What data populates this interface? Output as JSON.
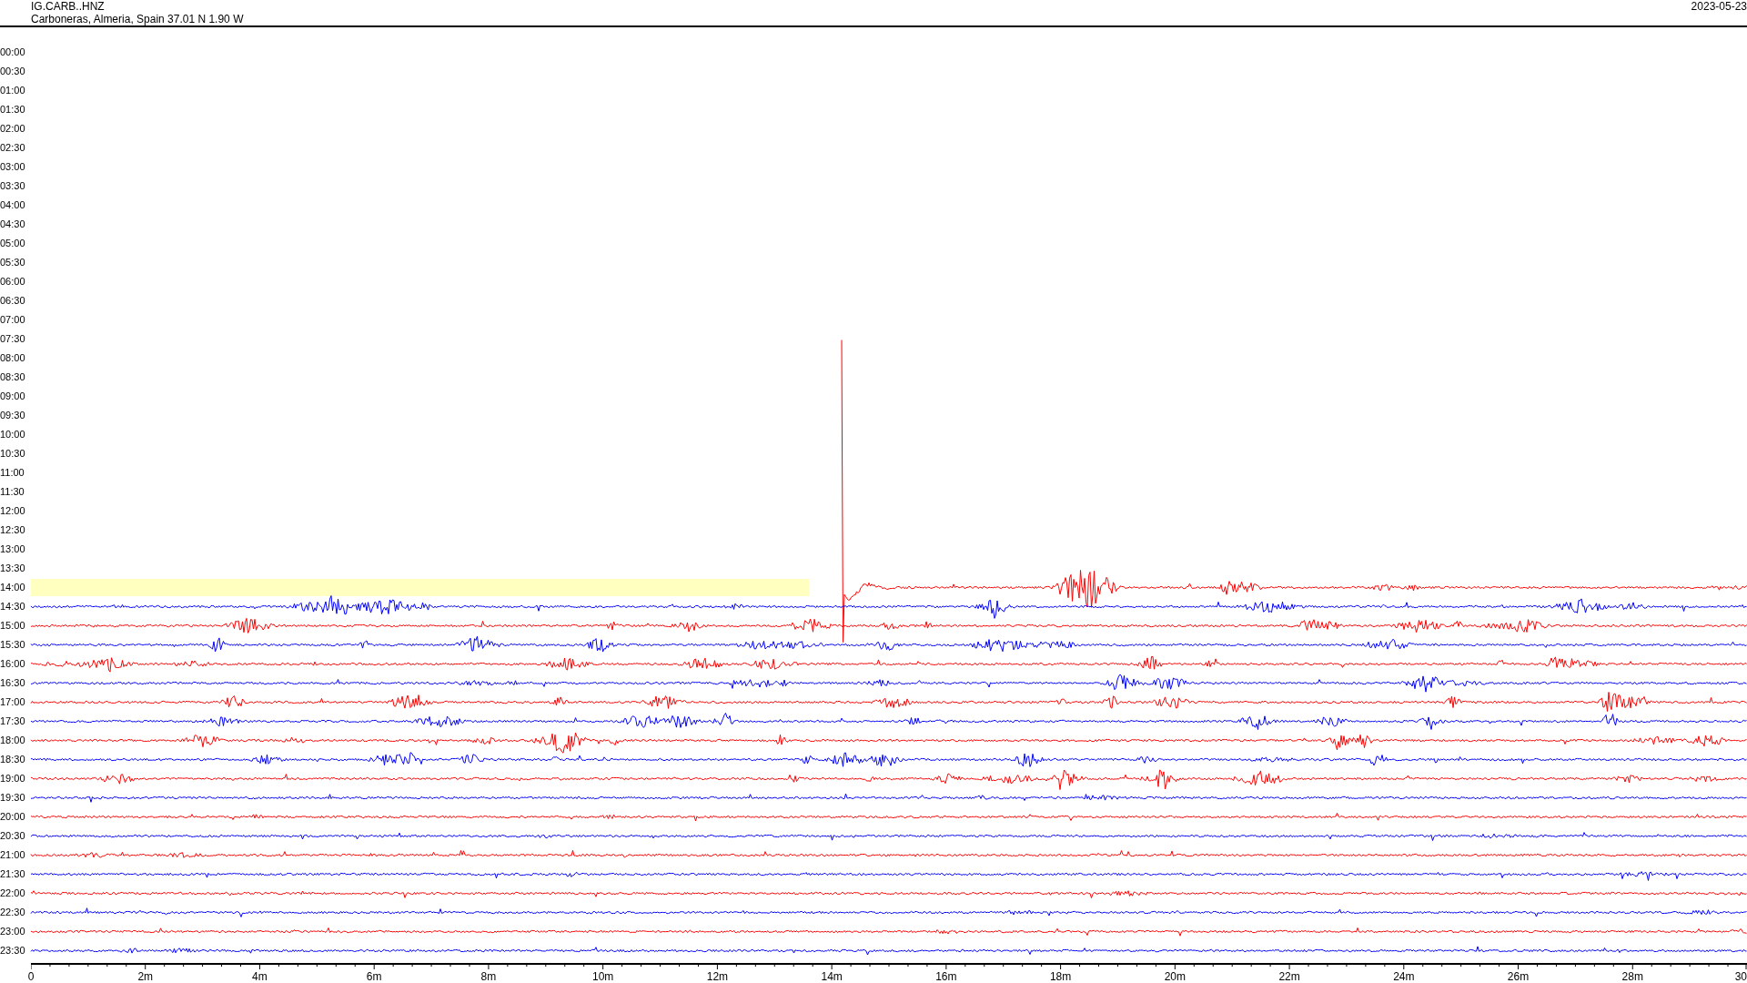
{
  "header": {
    "station": "IG.CARB..HNZ",
    "location": "Carboneras, Almeria, Spain  37.01 N 1.90 W",
    "date": "2023-05-23"
  },
  "rows": [
    {
      "time": "00:00",
      "highlighted": false
    },
    {
      "time": "00:30",
      "highlighted": false
    },
    {
      "time": "01:00",
      "highlighted": false
    },
    {
      "time": "01:30",
      "highlighted": false
    },
    {
      "time": "02:00",
      "highlighted": false
    },
    {
      "time": "02:30",
      "highlighted": false
    },
    {
      "time": "03:00",
      "highlighted": false
    },
    {
      "time": "03:30",
      "highlighted": false
    },
    {
      "time": "04:00",
      "highlighted": false
    },
    {
      "time": "04:30",
      "highlighted": false
    },
    {
      "time": "05:00",
      "highlighted": false
    },
    {
      "time": "05:30",
      "highlighted": false
    },
    {
      "time": "06:00",
      "highlighted": false
    },
    {
      "time": "06:30",
      "highlighted": false
    },
    {
      "time": "07:00",
      "highlighted": false
    },
    {
      "time": "07:30",
      "highlighted": false
    },
    {
      "time": "08:00",
      "highlighted": false
    },
    {
      "time": "08:30",
      "highlighted": false
    },
    {
      "time": "09:00",
      "highlighted": false
    },
    {
      "time": "09:30",
      "highlighted": false
    },
    {
      "time": "10:00",
      "highlighted": false
    },
    {
      "time": "10:30",
      "highlighted": false
    },
    {
      "time": "11:00",
      "highlighted": false
    },
    {
      "time": "11:30",
      "highlighted": false
    },
    {
      "time": "12:00",
      "highlighted": false
    },
    {
      "time": "12:30",
      "highlighted": false
    },
    {
      "time": "13:00",
      "highlighted": false
    },
    {
      "time": "13:30",
      "highlighted": false
    },
    {
      "time": "14:00",
      "highlighted": true,
      "color": "#ff0000"
    },
    {
      "time": "14:30",
      "highlighted": false,
      "color": "#0000ff"
    },
    {
      "time": "15:00",
      "highlighted": false,
      "color": "#ff0000"
    },
    {
      "time": "15:30",
      "highlighted": false,
      "color": "#0000ff"
    },
    {
      "time": "16:00",
      "highlighted": false,
      "color": "#ff0000"
    },
    {
      "time": "16:30",
      "highlighted": false,
      "color": "#0000ff"
    },
    {
      "time": "17:00",
      "highlighted": false,
      "color": "#ff0000"
    },
    {
      "time": "17:30",
      "highlighted": false,
      "color": "#0000ff"
    },
    {
      "time": "18:00",
      "highlighted": false,
      "color": "#ff0000"
    },
    {
      "time": "18:30",
      "highlighted": false,
      "color": "#0000ff"
    },
    {
      "time": "19:00",
      "highlighted": false,
      "color": "#ff0000"
    },
    {
      "time": "19:30",
      "highlighted": false,
      "color": "#0000ff"
    },
    {
      "time": "20:00",
      "highlighted": false,
      "color": "#ff0000"
    },
    {
      "time": "20:30",
      "highlighted": false,
      "color": "#0000ff"
    },
    {
      "time": "21:00",
      "highlighted": false,
      "color": "#ff0000"
    },
    {
      "time": "21:30",
      "highlighted": false,
      "color": "#0000ff"
    },
    {
      "time": "22:00",
      "highlighted": false,
      "color": "#ff0000"
    },
    {
      "time": "22:30",
      "highlighted": false,
      "color": "#0000ff"
    },
    {
      "time": "23:00",
      "highlighted": false,
      "color": "#ff0000"
    },
    {
      "time": "23:30",
      "highlighted": false,
      "color": "#0000ff"
    }
  ],
  "x_axis": {
    "labels": [
      "0",
      "2m",
      "4m",
      "6m",
      "8m",
      "10m",
      "12m",
      "14m",
      "16m",
      "18m",
      "20m",
      "22m",
      "24m",
      "26m",
      "28m",
      "30"
    ]
  }
}
